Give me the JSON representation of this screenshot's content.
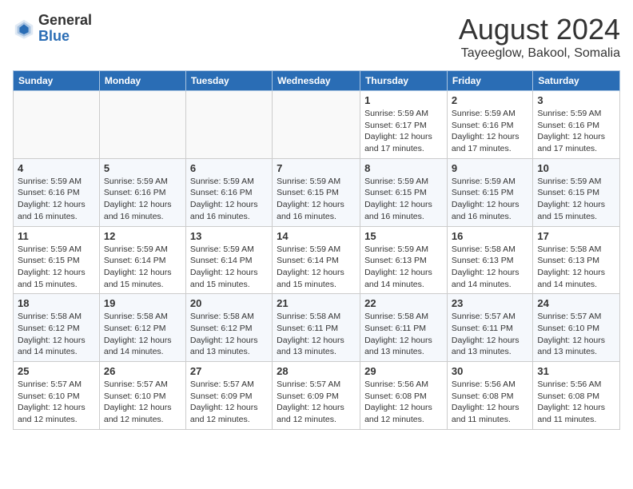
{
  "header": {
    "logo": {
      "general": "General",
      "blue": "Blue"
    },
    "month": "August 2024",
    "location": "Tayeeglow, Bakool, Somalia"
  },
  "weekdays": [
    "Sunday",
    "Monday",
    "Tuesday",
    "Wednesday",
    "Thursday",
    "Friday",
    "Saturday"
  ],
  "weeks": [
    [
      {
        "day": "",
        "info": ""
      },
      {
        "day": "",
        "info": ""
      },
      {
        "day": "",
        "info": ""
      },
      {
        "day": "",
        "info": ""
      },
      {
        "day": "1",
        "info": "Sunrise: 5:59 AM\nSunset: 6:17 PM\nDaylight: 12 hours\nand 17 minutes."
      },
      {
        "day": "2",
        "info": "Sunrise: 5:59 AM\nSunset: 6:16 PM\nDaylight: 12 hours\nand 17 minutes."
      },
      {
        "day": "3",
        "info": "Sunrise: 5:59 AM\nSunset: 6:16 PM\nDaylight: 12 hours\nand 17 minutes."
      }
    ],
    [
      {
        "day": "4",
        "info": "Sunrise: 5:59 AM\nSunset: 6:16 PM\nDaylight: 12 hours\nand 16 minutes."
      },
      {
        "day": "5",
        "info": "Sunrise: 5:59 AM\nSunset: 6:16 PM\nDaylight: 12 hours\nand 16 minutes."
      },
      {
        "day": "6",
        "info": "Sunrise: 5:59 AM\nSunset: 6:16 PM\nDaylight: 12 hours\nand 16 minutes."
      },
      {
        "day": "7",
        "info": "Sunrise: 5:59 AM\nSunset: 6:15 PM\nDaylight: 12 hours\nand 16 minutes."
      },
      {
        "day": "8",
        "info": "Sunrise: 5:59 AM\nSunset: 6:15 PM\nDaylight: 12 hours\nand 16 minutes."
      },
      {
        "day": "9",
        "info": "Sunrise: 5:59 AM\nSunset: 6:15 PM\nDaylight: 12 hours\nand 16 minutes."
      },
      {
        "day": "10",
        "info": "Sunrise: 5:59 AM\nSunset: 6:15 PM\nDaylight: 12 hours\nand 15 minutes."
      }
    ],
    [
      {
        "day": "11",
        "info": "Sunrise: 5:59 AM\nSunset: 6:15 PM\nDaylight: 12 hours\nand 15 minutes."
      },
      {
        "day": "12",
        "info": "Sunrise: 5:59 AM\nSunset: 6:14 PM\nDaylight: 12 hours\nand 15 minutes."
      },
      {
        "day": "13",
        "info": "Sunrise: 5:59 AM\nSunset: 6:14 PM\nDaylight: 12 hours\nand 15 minutes."
      },
      {
        "day": "14",
        "info": "Sunrise: 5:59 AM\nSunset: 6:14 PM\nDaylight: 12 hours\nand 15 minutes."
      },
      {
        "day": "15",
        "info": "Sunrise: 5:59 AM\nSunset: 6:13 PM\nDaylight: 12 hours\nand 14 minutes."
      },
      {
        "day": "16",
        "info": "Sunrise: 5:58 AM\nSunset: 6:13 PM\nDaylight: 12 hours\nand 14 minutes."
      },
      {
        "day": "17",
        "info": "Sunrise: 5:58 AM\nSunset: 6:13 PM\nDaylight: 12 hours\nand 14 minutes."
      }
    ],
    [
      {
        "day": "18",
        "info": "Sunrise: 5:58 AM\nSunset: 6:12 PM\nDaylight: 12 hours\nand 14 minutes."
      },
      {
        "day": "19",
        "info": "Sunrise: 5:58 AM\nSunset: 6:12 PM\nDaylight: 12 hours\nand 14 minutes."
      },
      {
        "day": "20",
        "info": "Sunrise: 5:58 AM\nSunset: 6:12 PM\nDaylight: 12 hours\nand 13 minutes."
      },
      {
        "day": "21",
        "info": "Sunrise: 5:58 AM\nSunset: 6:11 PM\nDaylight: 12 hours\nand 13 minutes."
      },
      {
        "day": "22",
        "info": "Sunrise: 5:58 AM\nSunset: 6:11 PM\nDaylight: 12 hours\nand 13 minutes."
      },
      {
        "day": "23",
        "info": "Sunrise: 5:57 AM\nSunset: 6:11 PM\nDaylight: 12 hours\nand 13 minutes."
      },
      {
        "day": "24",
        "info": "Sunrise: 5:57 AM\nSunset: 6:10 PM\nDaylight: 12 hours\nand 13 minutes."
      }
    ],
    [
      {
        "day": "25",
        "info": "Sunrise: 5:57 AM\nSunset: 6:10 PM\nDaylight: 12 hours\nand 12 minutes."
      },
      {
        "day": "26",
        "info": "Sunrise: 5:57 AM\nSunset: 6:10 PM\nDaylight: 12 hours\nand 12 minutes."
      },
      {
        "day": "27",
        "info": "Sunrise: 5:57 AM\nSunset: 6:09 PM\nDaylight: 12 hours\nand 12 minutes."
      },
      {
        "day": "28",
        "info": "Sunrise: 5:57 AM\nSunset: 6:09 PM\nDaylight: 12 hours\nand 12 minutes."
      },
      {
        "day": "29",
        "info": "Sunrise: 5:56 AM\nSunset: 6:08 PM\nDaylight: 12 hours\nand 12 minutes."
      },
      {
        "day": "30",
        "info": "Sunrise: 5:56 AM\nSunset: 6:08 PM\nDaylight: 12 hours\nand 11 minutes."
      },
      {
        "day": "31",
        "info": "Sunrise: 5:56 AM\nSunset: 6:08 PM\nDaylight: 12 hours\nand 11 minutes."
      }
    ]
  ]
}
